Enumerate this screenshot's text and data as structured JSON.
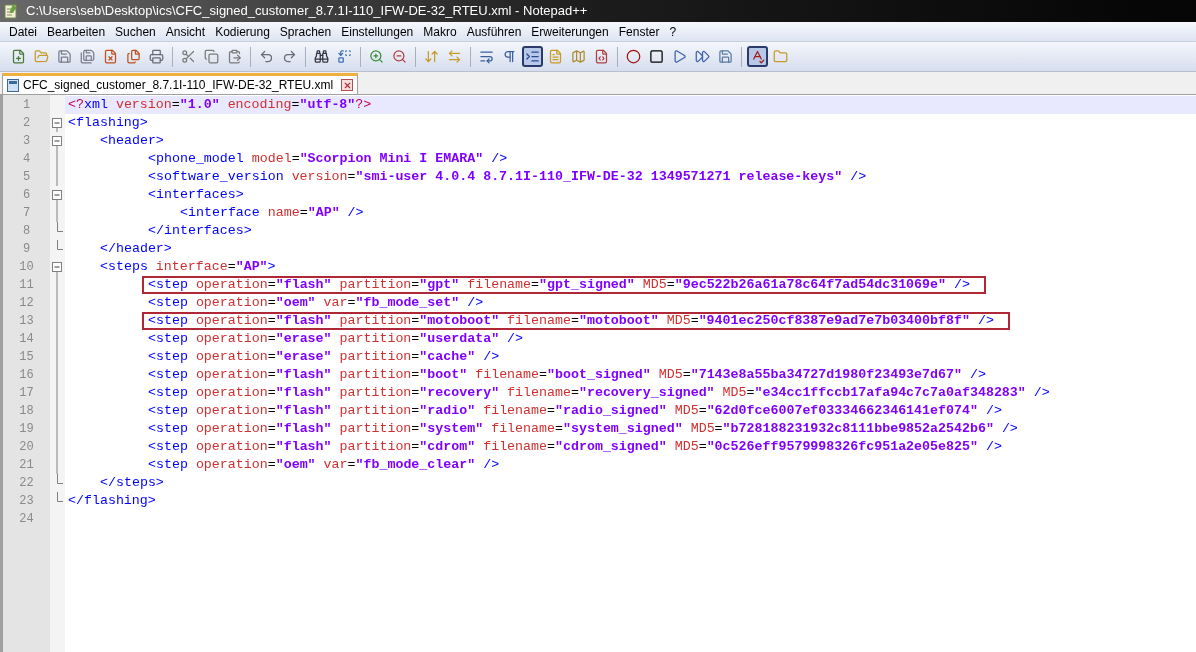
{
  "window": {
    "title": "C:\\Users\\seb\\Desktop\\ics\\CFC_signed_customer_8.7.1I-110_IFW-DE-32_RTEU.xml - Notepad++"
  },
  "menu": [
    "Datei",
    "Bearbeiten",
    "Suchen",
    "Ansicht",
    "Kodierung",
    "Sprachen",
    "Einstellungen",
    "Makro",
    "Ausführen",
    "Erweiterungen",
    "Fenster",
    "?"
  ],
  "toolbar": [
    [
      {
        "kind": "new",
        "on": false
      },
      {
        "kind": "open",
        "on": false
      },
      {
        "kind": "save",
        "on": false
      },
      {
        "kind": "save-all",
        "on": false
      },
      {
        "kind": "close",
        "on": false
      },
      {
        "kind": "close-all",
        "on": false
      },
      {
        "kind": "print",
        "on": false
      }
    ],
    [
      {
        "kind": "cut",
        "on": false
      },
      {
        "kind": "copy",
        "on": false
      },
      {
        "kind": "paste",
        "on": false
      }
    ],
    [
      {
        "kind": "undo",
        "on": false
      },
      {
        "kind": "redo",
        "on": false
      }
    ],
    [
      {
        "kind": "find",
        "on": false
      },
      {
        "kind": "replace",
        "on": false
      }
    ],
    [
      {
        "kind": "zoom-in",
        "on": false
      },
      {
        "kind": "zoom-out",
        "on": false
      }
    ],
    [
      {
        "kind": "sync-v",
        "on": false
      },
      {
        "kind": "sync-h",
        "on": false
      }
    ],
    [
      {
        "kind": "wrap",
        "on": false
      },
      {
        "kind": "all-chars",
        "on": false
      },
      {
        "kind": "indent-guide",
        "on": true
      },
      {
        "kind": "doc",
        "on": false
      },
      {
        "kind": "map",
        "on": false
      },
      {
        "kind": "function",
        "on": false
      }
    ],
    [
      {
        "kind": "record",
        "on": false
      },
      {
        "kind": "stop",
        "on": false
      },
      {
        "kind": "play",
        "on": false
      },
      {
        "kind": "play-multi",
        "on": false
      },
      {
        "kind": "save-macro",
        "on": false
      }
    ],
    [
      {
        "kind": "spellcheck",
        "on": true
      },
      {
        "kind": "folder",
        "on": false
      }
    ]
  ],
  "tabs": [
    {
      "label": "CFC_signed_customer_8.7.1I-110_IFW-DE-32_RTEU.xml",
      "selected": true
    }
  ],
  "lines": [
    {
      "number": "1",
      "current": true,
      "marked": false,
      "tokens": [
        {
          "kind": "pi",
          "text": "<?"
        },
        {
          "kind": "tag",
          "text": "xml"
        },
        {
          "kind": "attr",
          "text": " version"
        },
        {
          "kind": "eq",
          "text": "="
        },
        {
          "kind": "val",
          "text": "\"1.0\""
        },
        {
          "kind": "attr",
          "text": " encoding"
        },
        {
          "kind": "eq",
          "text": "="
        },
        {
          "kind": "val",
          "text": "\"utf-8\""
        },
        {
          "kind": "pi",
          "text": "?>"
        }
      ]
    },
    {
      "open": {
        "number": "2",
        "current": false,
        "marked": false,
        "tokens": [
          {
            "kind": "tag",
            "text": "<flashing>"
          }
        ]
      },
      "children": [
        {
          "open": {
            "number": "3",
            "current": false,
            "marked": false,
            "tokens": [
              {
                "kind": "tag",
                "text": "<header>"
              }
            ]
          },
          "children": [
            {
              "number": "4",
              "current": false,
              "marked": false,
              "tokens": [
                {
                  "kind": "tag",
                  "text": "<phone_model"
                },
                {
                  "kind": "attr",
                  "text": " model"
                },
                {
                  "kind": "eq",
                  "text": "="
                },
                {
                  "kind": "val",
                  "text": "\"Scorpion Mini I EMARA\""
                },
                {
                  "kind": "tag",
                  "text": " />"
                }
              ]
            },
            {
              "number": "5",
              "current": false,
              "marked": false,
              "tokens": [
                {
                  "kind": "tag",
                  "text": "<software_version"
                },
                {
                  "kind": "attr",
                  "text": " version"
                },
                {
                  "kind": "eq",
                  "text": "="
                },
                {
                  "kind": "val",
                  "text": "\"smi-user 4.0.4 8.7.1I-110_IFW-DE-32 1349571271 release-keys\""
                },
                {
                  "kind": "tag",
                  "text": " />"
                }
              ]
            },
            {
              "open": {
                "number": "6",
                "current": false,
                "marked": false,
                "tokens": [
                  {
                    "kind": "tag",
                    "text": "<interfaces>"
                  }
                ]
              },
              "children": [
                {
                  "number": "7",
                  "current": false,
                  "marked": false,
                  "tokens": [
                    {
                      "kind": "tag",
                      "text": "<interface"
                    },
                    {
                      "kind": "attr",
                      "text": " name"
                    },
                    {
                      "kind": "eq",
                      "text": "="
                    },
                    {
                      "kind": "val",
                      "text": "\"AP\""
                    },
                    {
                      "kind": "tag",
                      "text": " />"
                    }
                  ]
                }
              ],
              "close": {
                "number": "8",
                "current": false,
                "marked": false,
                "tokens": [
                  {
                    "kind": "tag",
                    "text": "</interfaces>"
                  }
                ]
              }
            }
          ],
          "close": {
            "number": "9",
            "current": false,
            "marked": false,
            "tokens": [
              {
                "kind": "tag",
                "text": "</header>"
              }
            ]
          }
        },
        {
          "open": {
            "number": "10",
            "current": false,
            "marked": false,
            "tokens": [
              {
                "kind": "tag",
                "text": "<steps"
              },
              {
                "kind": "attr",
                "text": " interface"
              },
              {
                "kind": "eq",
                "text": "="
              },
              {
                "kind": "val",
                "text": "\"AP\""
              },
              {
                "kind": "tag",
                "text": ">"
              }
            ]
          },
          "children": [
            {
              "number": "11",
              "current": false,
              "marked": true,
              "tokens": [
                {
                  "kind": "tag",
                  "text": "<step"
                },
                {
                  "kind": "attr",
                  "text": " operation"
                },
                {
                  "kind": "eq",
                  "text": "="
                },
                {
                  "kind": "val",
                  "text": "\"flash\""
                },
                {
                  "kind": "attr",
                  "text": " partition"
                },
                {
                  "kind": "eq",
                  "text": "="
                },
                {
                  "kind": "val",
                  "text": "\"gpt\""
                },
                {
                  "kind": "attr",
                  "text": " filename"
                },
                {
                  "kind": "eq",
                  "text": "="
                },
                {
                  "kind": "val",
                  "text": "\"gpt_signed\""
                },
                {
                  "kind": "attr",
                  "text": " MD5"
                },
                {
                  "kind": "eq",
                  "text": "="
                },
                {
                  "kind": "val",
                  "text": "\"9ec522b26a61a78c64f7ad54dc31069e\""
                },
                {
                  "kind": "tag",
                  "text": " />"
                }
              ]
            },
            {
              "number": "12",
              "current": false,
              "marked": false,
              "tokens": [
                {
                  "kind": "tag",
                  "text": "<step"
                },
                {
                  "kind": "attr",
                  "text": " operation"
                },
                {
                  "kind": "eq",
                  "text": "="
                },
                {
                  "kind": "val",
                  "text": "\"oem\""
                },
                {
                  "kind": "attr",
                  "text": " var"
                },
                {
                  "kind": "eq",
                  "text": "="
                },
                {
                  "kind": "val",
                  "text": "\"fb_mode_set\""
                },
                {
                  "kind": "tag",
                  "text": " />"
                }
              ]
            },
            {
              "number": "13",
              "current": false,
              "marked": true,
              "tokens": [
                {
                  "kind": "tag",
                  "text": "<step"
                },
                {
                  "kind": "attr",
                  "text": " operation"
                },
                {
                  "kind": "eq",
                  "text": "="
                },
                {
                  "kind": "val",
                  "text": "\"flash\""
                },
                {
                  "kind": "attr",
                  "text": " partition"
                },
                {
                  "kind": "eq",
                  "text": "="
                },
                {
                  "kind": "val",
                  "text": "\"motoboot\""
                },
                {
                  "kind": "attr",
                  "text": " filename"
                },
                {
                  "kind": "eq",
                  "text": "="
                },
                {
                  "kind": "val",
                  "text": "\"motoboot\""
                },
                {
                  "kind": "attr",
                  "text": " MD5"
                },
                {
                  "kind": "eq",
                  "text": "="
                },
                {
                  "kind": "val",
                  "text": "\"9401ec250cf8387e9ad7e7b03400bf8f\""
                },
                {
                  "kind": "tag",
                  "text": " />"
                }
              ]
            },
            {
              "number": "14",
              "current": false,
              "marked": false,
              "tokens": [
                {
                  "kind": "tag",
                  "text": "<step"
                },
                {
                  "kind": "attr",
                  "text": " operation"
                },
                {
                  "kind": "eq",
                  "text": "="
                },
                {
                  "kind": "val",
                  "text": "\"erase\""
                },
                {
                  "kind": "attr",
                  "text": " partition"
                },
                {
                  "kind": "eq",
                  "text": "="
                },
                {
                  "kind": "val",
                  "text": "\"userdata\""
                },
                {
                  "kind": "tag",
                  "text": " />"
                }
              ]
            },
            {
              "number": "15",
              "current": false,
              "marked": false,
              "tokens": [
                {
                  "kind": "tag",
                  "text": "<step"
                },
                {
                  "kind": "attr",
                  "text": " operation"
                },
                {
                  "kind": "eq",
                  "text": "="
                },
                {
                  "kind": "val",
                  "text": "\"erase\""
                },
                {
                  "kind": "attr",
                  "text": " partition"
                },
                {
                  "kind": "eq",
                  "text": "="
                },
                {
                  "kind": "val",
                  "text": "\"cache\""
                },
                {
                  "kind": "tag",
                  "text": " />"
                }
              ]
            },
            {
              "number": "16",
              "current": false,
              "marked": false,
              "tokens": [
                {
                  "kind": "tag",
                  "text": "<step"
                },
                {
                  "kind": "attr",
                  "text": " operation"
                },
                {
                  "kind": "eq",
                  "text": "="
                },
                {
                  "kind": "val",
                  "text": "\"flash\""
                },
                {
                  "kind": "attr",
                  "text": " partition"
                },
                {
                  "kind": "eq",
                  "text": "="
                },
                {
                  "kind": "val",
                  "text": "\"boot\""
                },
                {
                  "kind": "attr",
                  "text": " filename"
                },
                {
                  "kind": "eq",
                  "text": "="
                },
                {
                  "kind": "val",
                  "text": "\"boot_signed\""
                },
                {
                  "kind": "attr",
                  "text": " MD5"
                },
                {
                  "kind": "eq",
                  "text": "="
                },
                {
                  "kind": "val",
                  "text": "\"7143e8a55ba34727d1980f23493e7d67\""
                },
                {
                  "kind": "tag",
                  "text": " />"
                }
              ]
            },
            {
              "number": "17",
              "current": false,
              "marked": false,
              "tokens": [
                {
                  "kind": "tag",
                  "text": "<step"
                },
                {
                  "kind": "attr",
                  "text": " operation"
                },
                {
                  "kind": "eq",
                  "text": "="
                },
                {
                  "kind": "val",
                  "text": "\"flash\""
                },
                {
                  "kind": "attr",
                  "text": " partition"
                },
                {
                  "kind": "eq",
                  "text": "="
                },
                {
                  "kind": "val",
                  "text": "\"recovery\""
                },
                {
                  "kind": "attr",
                  "text": " filename"
                },
                {
                  "kind": "eq",
                  "text": "="
                },
                {
                  "kind": "val",
                  "text": "\"recovery_signed\""
                },
                {
                  "kind": "attr",
                  "text": " MD5"
                },
                {
                  "kind": "eq",
                  "text": "="
                },
                {
                  "kind": "val",
                  "text": "\"e34cc1ffccb17afa94c7c7a0af348283\""
                },
                {
                  "kind": "tag",
                  "text": " />"
                }
              ]
            },
            {
              "number": "18",
              "current": false,
              "marked": false,
              "tokens": [
                {
                  "kind": "tag",
                  "text": "<step"
                },
                {
                  "kind": "attr",
                  "text": " operation"
                },
                {
                  "kind": "eq",
                  "text": "="
                },
                {
                  "kind": "val",
                  "text": "\"flash\""
                },
                {
                  "kind": "attr",
                  "text": " partition"
                },
                {
                  "kind": "eq",
                  "text": "="
                },
                {
                  "kind": "val",
                  "text": "\"radio\""
                },
                {
                  "kind": "attr",
                  "text": " filename"
                },
                {
                  "kind": "eq",
                  "text": "="
                },
                {
                  "kind": "val",
                  "text": "\"radio_signed\""
                },
                {
                  "kind": "attr",
                  "text": " MD5"
                },
                {
                  "kind": "eq",
                  "text": "="
                },
                {
                  "kind": "val",
                  "text": "\"62d0fce6007ef03334662346141ef074\""
                },
                {
                  "kind": "tag",
                  "text": " />"
                }
              ]
            },
            {
              "number": "19",
              "current": false,
              "marked": false,
              "tokens": [
                {
                  "kind": "tag",
                  "text": "<step"
                },
                {
                  "kind": "attr",
                  "text": " operation"
                },
                {
                  "kind": "eq",
                  "text": "="
                },
                {
                  "kind": "val",
                  "text": "\"flash\""
                },
                {
                  "kind": "attr",
                  "text": " partition"
                },
                {
                  "kind": "eq",
                  "text": "="
                },
                {
                  "kind": "val",
                  "text": "\"system\""
                },
                {
                  "kind": "attr",
                  "text": " filename"
                },
                {
                  "kind": "eq",
                  "text": "="
                },
                {
                  "kind": "val",
                  "text": "\"system_signed\""
                },
                {
                  "kind": "attr",
                  "text": " MD5"
                },
                {
                  "kind": "eq",
                  "text": "="
                },
                {
                  "kind": "val",
                  "text": "\"b728188231932c8111bbe9852a2542b6\""
                },
                {
                  "kind": "tag",
                  "text": " />"
                }
              ]
            },
            {
              "number": "20",
              "current": false,
              "marked": false,
              "tokens": [
                {
                  "kind": "tag",
                  "text": "<step"
                },
                {
                  "kind": "attr",
                  "text": " operation"
                },
                {
                  "kind": "eq",
                  "text": "="
                },
                {
                  "kind": "val",
                  "text": "\"flash\""
                },
                {
                  "kind": "attr",
                  "text": " partition"
                },
                {
                  "kind": "eq",
                  "text": "="
                },
                {
                  "kind": "val",
                  "text": "\"cdrom\""
                },
                {
                  "kind": "attr",
                  "text": " filename"
                },
                {
                  "kind": "eq",
                  "text": "="
                },
                {
                  "kind": "val",
                  "text": "\"cdrom_signed\""
                },
                {
                  "kind": "attr",
                  "text": " MD5"
                },
                {
                  "kind": "eq",
                  "text": "="
                },
                {
                  "kind": "val",
                  "text": "\"0c526eff9579998326fc951a2e05e825\""
                },
                {
                  "kind": "tag",
                  "text": " />"
                }
              ]
            },
            {
              "number": "21",
              "current": false,
              "marked": false,
              "tokens": [
                {
                  "kind": "tag",
                  "text": "<step"
                },
                {
                  "kind": "attr",
                  "text": " operation"
                },
                {
                  "kind": "eq",
                  "text": "="
                },
                {
                  "kind": "val",
                  "text": "\"oem\""
                },
                {
                  "kind": "attr",
                  "text": " var"
                },
                {
                  "kind": "eq",
                  "text": "="
                },
                {
                  "kind": "val",
                  "text": "\"fb_mode_clear\""
                },
                {
                  "kind": "tag",
                  "text": " />"
                }
              ]
            }
          ],
          "close": {
            "number": "22",
            "current": false,
            "marked": false,
            "tokens": [
              {
                "kind": "tag",
                "text": "</steps>"
              }
            ]
          }
        }
      ],
      "close": {
        "number": "23",
        "current": false,
        "marked": false,
        "tokens": [
          {
            "kind": "tag",
            "text": "</flashing>"
          }
        ]
      }
    },
    {
      "number": "24",
      "current": false,
      "marked": false
    }
  ]
}
